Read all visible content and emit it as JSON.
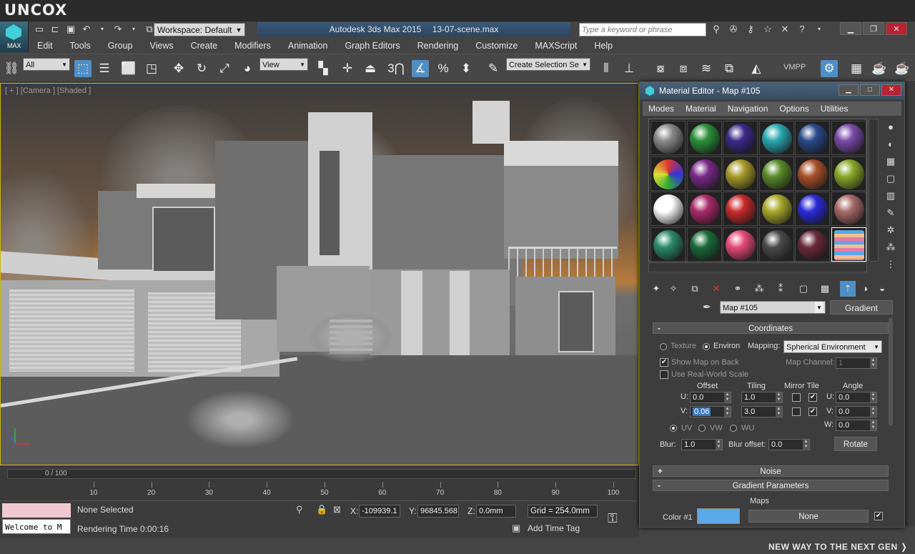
{
  "brand": "UNCOX",
  "max_logo_label": "MAX",
  "workspace": "Workspace: Default",
  "app_title": {
    "product": "Autodesk 3ds Max  2015",
    "file": "13-07-scene.max"
  },
  "search_placeholder": "Type a keyword or phrase",
  "menu": [
    "Edit",
    "Tools",
    "Group",
    "Views",
    "Create",
    "Modifiers",
    "Animation",
    "Graph Editors",
    "Rendering",
    "Customize",
    "MAXScript",
    "Help"
  ],
  "toolbar": {
    "selection_filter": "All",
    "ref_coord": "View",
    "snap_value": "3",
    "named_selection": "Create Selection Se",
    "vmpp": "VMPP"
  },
  "viewport": {
    "label": "[ + ] [Camera ] [Shaded ]"
  },
  "timeline": {
    "slider_label": "0 / 100",
    "ticks": [
      "10",
      "20",
      "30",
      "40",
      "50",
      "60",
      "70",
      "80",
      "90",
      "100"
    ]
  },
  "status": {
    "maxscript_text": "Welcome to M",
    "selection": "None Selected",
    "render_time": "Rendering Time  0:00:16",
    "x_label": "X:",
    "x_value": "-109939.1",
    "y_label": "Y:",
    "y_value": "96845.568",
    "z_label": "Z:",
    "z_value": "0.0mm",
    "grid": "Grid = 254.0mm",
    "add_time_tag": "Add Time Tag"
  },
  "footer": "NEW WAY TO THE NEXT GEN ❭",
  "material_editor": {
    "title": "Material Editor - Map #105",
    "menu": [
      "Modes",
      "Material",
      "Navigation",
      "Options",
      "Utilities"
    ],
    "map_name": "Map #105",
    "map_type": "Gradient",
    "slot_colors": [
      "#8a8a8a",
      "#2b8f3a",
      "#3b2a8a",
      "#2aa7b0",
      "#2a4a8a",
      "#7a4aa8",
      "#8a3a6a",
      "#7a2a8a",
      "#a89a2a",
      "#5a8a2a",
      "#a8502a",
      "#8aa82a",
      "#ffffff",
      "#a82a6a",
      "#c82a2a",
      "#a8a82a",
      "#2a2ad8",
      "#a86a6a",
      "#2a8a6a",
      "#1a6a3a",
      "#e84a7a",
      "#4a4a4a",
      "#6a2a3a",
      "#e0a070"
    ],
    "coordinates": {
      "header": "Coordinates",
      "texture_label": "Texture",
      "environ_label": "Environ",
      "mapping_label": "Mapping:",
      "mapping_value": "Spherical Environment",
      "show_map_on_back": "Show Map on Back",
      "map_channel_label": "Map Channel:",
      "map_channel_value": "1",
      "use_real_world": "Use Real-World Scale",
      "offset_header": "Offset",
      "tiling_header": "Tiling",
      "mirror_tile_header": "Mirror Tile",
      "angle_header": "Angle",
      "u_label": "U:",
      "v_label": "V:",
      "w_label": "W:",
      "offset_u": "0.0",
      "offset_v": "0.06",
      "tiling_u": "1.0",
      "tiling_v": "3.0",
      "angle_u": "0.0",
      "angle_v": "0.0",
      "angle_w": "0.0",
      "uv": "UV",
      "vw": "VW",
      "wu": "WU",
      "blur_label": "Blur:",
      "blur_value": "1.0",
      "blur_offset_label": "Blur offset:",
      "blur_offset_value": "0.0",
      "rotate": "Rotate"
    },
    "noise_header": "Noise",
    "gradient_header": "Gradient Parameters",
    "maps_label": "Maps",
    "color1_label": "Color #1",
    "color1_map": "None",
    "color1_hex": "#5aa9e8"
  }
}
